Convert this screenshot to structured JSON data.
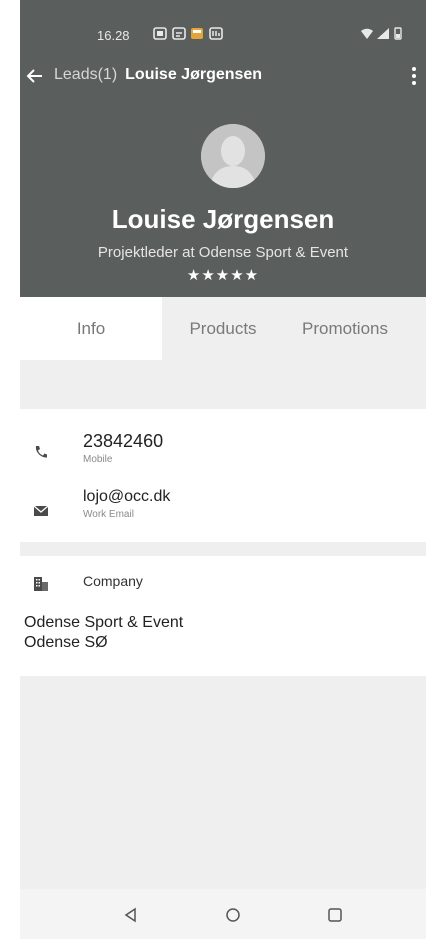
{
  "status_bar": {
    "time": "16.28"
  },
  "app_bar": {
    "breadcrumb_prev": "Leads(1)",
    "breadcrumb_current": "Louise Jørgensen"
  },
  "profile": {
    "name": "Louise Jørgensen",
    "subtitle": "Projektleder at Odense Sport & Event",
    "rating_text": "★★★★★",
    "rating": 5
  },
  "tabs": [
    {
      "label": "Info",
      "active": true
    },
    {
      "label": "Products",
      "active": false
    },
    {
      "label": "Promotions",
      "active": false
    }
  ],
  "contact": {
    "phone": {
      "value": "23842460",
      "type": "Mobile"
    },
    "email": {
      "value": "lojo@occ.dk",
      "type": "Work Email"
    }
  },
  "company": {
    "heading": "Company",
    "name": "Odense Sport & Event",
    "city": "Odense SØ"
  },
  "colors": {
    "header_bg": "#5a5e5d",
    "page_bg": "#efefef",
    "card_bg": "#ffffff"
  },
  "icons": [
    "back-arrow-icon",
    "overflow-menu-icon",
    "avatar-icon",
    "phone-icon",
    "email-icon",
    "company-icon",
    "nav-back-icon",
    "nav-home-icon",
    "nav-recents-icon"
  ]
}
